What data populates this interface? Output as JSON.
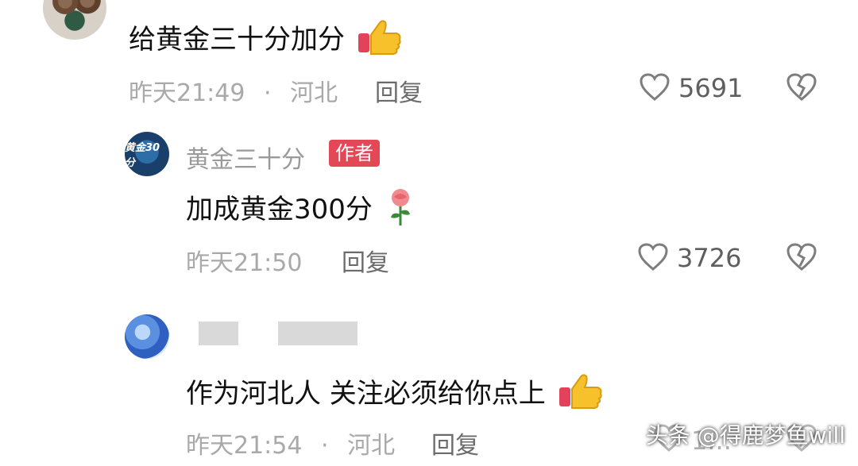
{
  "comments": [
    {
      "text": "给黄金三十分加分",
      "timestamp": "昨天21:49",
      "separator": "·",
      "location": "河北",
      "reply_label": "回复",
      "likes": "5691"
    },
    {
      "username": "黄金三十分",
      "badge": "作者",
      "avatar_text": "黄金30分",
      "text": "加成黄金300分",
      "timestamp": "昨天21:50",
      "reply_label": "回复",
      "likes": "3726"
    },
    {
      "text": "作为河北人 关注必须给你点上",
      "timestamp": "昨天21:54",
      "separator": "·",
      "location": "河北",
      "reply_label": "回复",
      "likes": "1..."
    }
  ],
  "watermark": "头条 @得鹿梦鱼will",
  "icons": {
    "like": "heart-outline-icon",
    "dislike": "broken-heart-icon",
    "thumbs_up": "thumbs-up-emoji",
    "rose": "rose-emoji"
  }
}
